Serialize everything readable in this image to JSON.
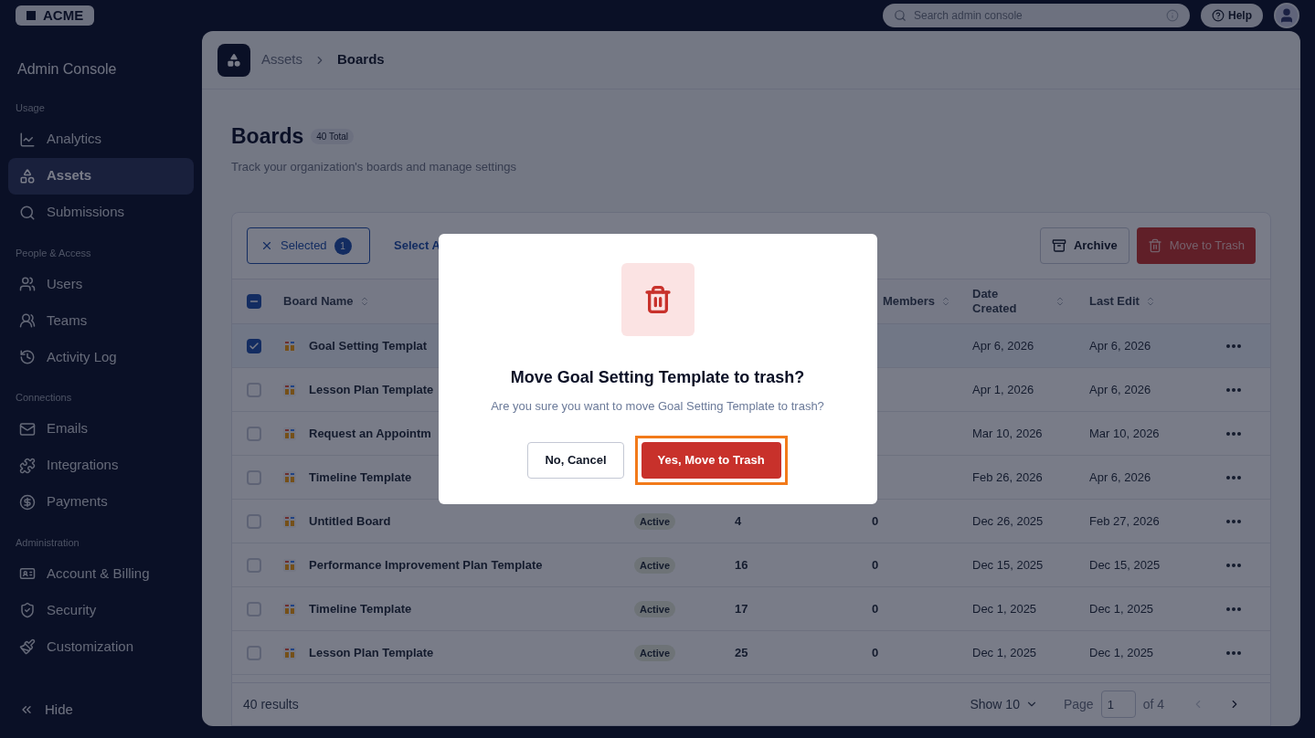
{
  "topbar": {
    "logo": "ACME",
    "search": {
      "placeholder": "Search admin console"
    },
    "help": "Help"
  },
  "sidebar": {
    "title": "Admin Console",
    "sections": [
      {
        "label": "Usage",
        "items": [
          {
            "label": "Analytics",
            "selected": false
          },
          {
            "label": "Assets",
            "selected": true
          },
          {
            "label": "Submissions",
            "selected": false
          }
        ]
      },
      {
        "label": "People & Access",
        "items": [
          {
            "label": "Users",
            "selected": false
          },
          {
            "label": "Teams",
            "selected": false
          },
          {
            "label": "Activity Log",
            "selected": false
          }
        ]
      },
      {
        "label": "Connections",
        "items": [
          {
            "label": "Emails",
            "selected": false
          },
          {
            "label": "Integrations",
            "selected": false
          },
          {
            "label": "Payments",
            "selected": false
          }
        ]
      },
      {
        "label": "Administration",
        "items": [
          {
            "label": "Account & Billing",
            "selected": false
          },
          {
            "label": "Security",
            "selected": false
          },
          {
            "label": "Customization",
            "selected": false
          }
        ]
      }
    ],
    "hide": "Hide"
  },
  "breadcrumb": [
    "Assets",
    "Boards"
  ],
  "page": {
    "title": "Boards",
    "count": "40 Total",
    "subtitle": "Track your organization's boards and manage settings"
  },
  "toolbar": {
    "selected": {
      "label": "Selected",
      "count": "1"
    },
    "select_all": "Select A",
    "archive": "Archive",
    "trash": "Move to Trash"
  },
  "table": {
    "header_checkbox": {
      "indeterminate": true
    },
    "columns": [
      "Board Name",
      "Members",
      "Date Created",
      "Last Edit"
    ],
    "rows": [
      {
        "checked": true,
        "name": "Goal Setting Templat",
        "created": "Apr 6, 2026",
        "edited": "Apr 6, 2026"
      },
      {
        "checked": false,
        "name": "Lesson Plan Template",
        "created": "Apr 1, 2026",
        "edited": "Apr 6, 2026"
      },
      {
        "checked": false,
        "name": "Request an Appointm",
        "created": "Mar 10, 2026",
        "edited": "Mar 10, 2026"
      },
      {
        "checked": false,
        "name": "Timeline Template",
        "created": "Feb 26, 2026",
        "edited": "Apr 6, 2026"
      },
      {
        "checked": false,
        "name": "Untitled Board",
        "status": "Active",
        "column_3": "4",
        "members": "0",
        "created": "Dec 26, 2025",
        "edited": "Feb 27, 2026"
      },
      {
        "checked": false,
        "name": "Performance Improvement Plan Template",
        "status": "Active",
        "column_3": "16",
        "members": "0",
        "created": "Dec 15, 2025",
        "edited": "Dec 15, 2025"
      },
      {
        "checked": false,
        "name": "Timeline Template",
        "status": "Active",
        "column_3": "17",
        "members": "0",
        "created": "Dec 1, 2025",
        "edited": "Dec 1, 2025"
      },
      {
        "checked": false,
        "name": "Lesson Plan Template",
        "status": "Active",
        "column_3": "25",
        "members": "0",
        "created": "Dec 1, 2025",
        "edited": "Dec 1, 2025"
      }
    ]
  },
  "footer": {
    "results": "40 results",
    "show": "Show 10",
    "page_label": "Page",
    "page": "1",
    "of": "of 4"
  },
  "dialog": {
    "title": "Move Goal Setting Template to trash?",
    "message": "Are you sure you want to move Goal Setting Template to trash?",
    "cancel": "No, Cancel",
    "confirm": {
      "label": "Yes, Move to Trash",
      "focused": true
    }
  }
}
